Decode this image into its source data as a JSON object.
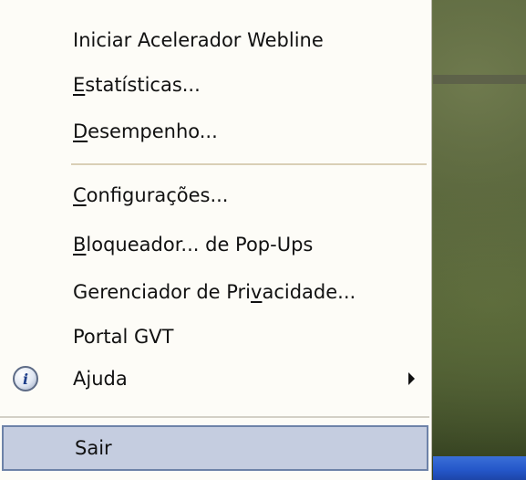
{
  "menu": {
    "items": [
      {
        "before": "Iniciar Acelerador Webline",
        "u": "",
        "after": ""
      },
      {
        "before": "",
        "u": "E",
        "after": "statísticas..."
      },
      {
        "before": "",
        "u": "D",
        "after": "esempenho..."
      },
      {
        "before": "",
        "u": "C",
        "after": "onfigurações..."
      },
      {
        "before": "",
        "u": "B",
        "after": "loqueador... de Pop-Ups"
      },
      {
        "before": "Gerenciador de Pri",
        "u": "v",
        "after": "acidade..."
      },
      {
        "before": "Portal GVT",
        "u": "",
        "after": ""
      },
      {
        "before": "Ajuda",
        "u": "",
        "after": ""
      },
      {
        "before": "Sair",
        "u": "",
        "after": ""
      }
    ],
    "icons": {
      "help": "info-icon",
      "submenu": "submenu-arrow-icon",
      "help_glyph": "i"
    },
    "colors": {
      "background": "#fdfcf7",
      "selection": "#c5cde0",
      "selection_border": "#6d82a8"
    }
  }
}
